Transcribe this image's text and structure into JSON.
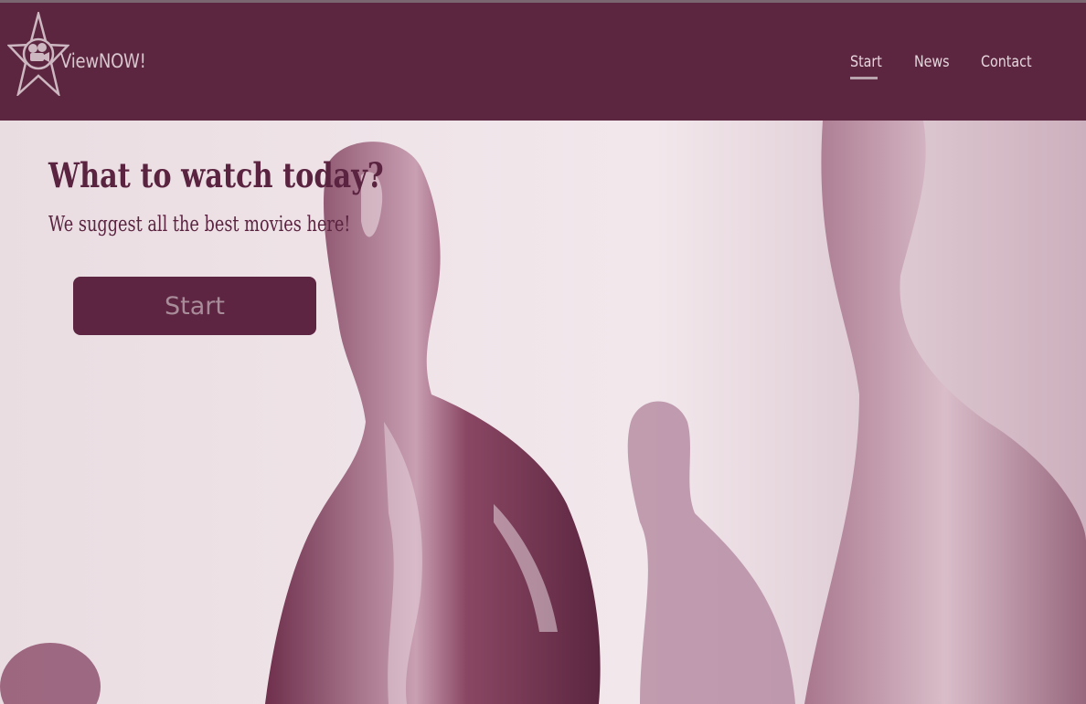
{
  "brand": {
    "name": "ViewNOW!",
    "logo_icon": "film-camera-star-icon"
  },
  "nav": {
    "items": [
      "Start",
      "News",
      "Contact"
    ],
    "active": "Start"
  },
  "hero": {
    "title": "What to watch today?",
    "subtitle": "We suggest all the best movies here!",
    "cta_label": "Start",
    "background_image": "award-statuettes-photo"
  },
  "colors": {
    "header_bg": "#5c2640",
    "accent": "#5d2541",
    "hero_tint": "#e9d9df",
    "nav_text": "#e6d6dd"
  }
}
